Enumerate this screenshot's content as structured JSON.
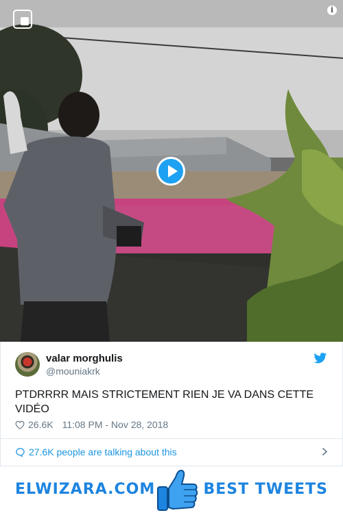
{
  "tweet": {
    "display_name": "valar morghulis",
    "handle": "@mouniakrk",
    "text": "PTDRRRR MAIS STRICTEMENT RIEN JE VA DANS CETTE VIDÉO",
    "likes": "26.6K",
    "timestamp": "11:08 PM - Nov 28, 2018",
    "talking_link": "27.6K people are talking about this"
  },
  "video": {
    "media_icon": "media-badge-icon",
    "info_icon": "info-icon",
    "info_glyph": "i",
    "play_icon": "play-icon"
  },
  "banner": {
    "site_name": "ELWIZARA.COM",
    "tagline": "BEST TWEETS"
  },
  "colors": {
    "twitter_blue": "#1da1f2",
    "link_blue": "#1b95e0",
    "banner_blue": "#1d84e0",
    "muted_gray": "#657786",
    "border": "#e1e8ed"
  }
}
